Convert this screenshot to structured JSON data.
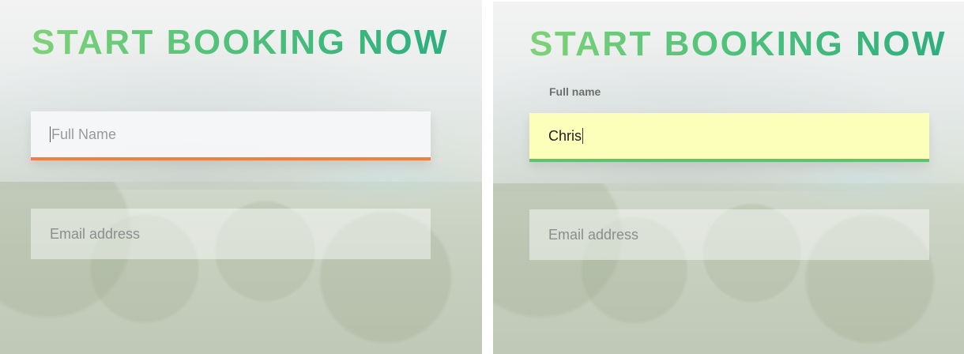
{
  "left_panel": {
    "heading": "START BOOKING NOW",
    "name_field": {
      "placeholder": "Full Name",
      "value": "",
      "state": "focused-empty",
      "accent_color": "#ee7f45"
    },
    "email_field": {
      "placeholder": "Email address",
      "value": ""
    }
  },
  "right_panel": {
    "heading": "START BOOKING NOW",
    "name_field": {
      "label": "Full name",
      "value": "Chris",
      "state": "focused-filled",
      "accent_color": "#5cc46b",
      "fill_color": "#fbffb9"
    },
    "email_field": {
      "placeholder": "Email address",
      "value": ""
    }
  },
  "colors": {
    "heading_gradient_start": "#7fd278",
    "heading_gradient_end": "#2eae7f"
  }
}
